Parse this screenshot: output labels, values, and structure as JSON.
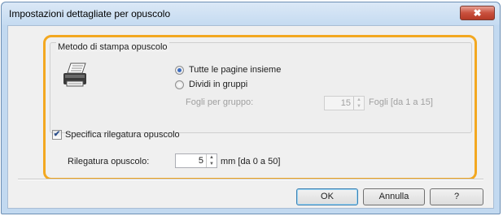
{
  "window": {
    "title": "Impostazioni dettagliate per opuscolo",
    "close_label": "✖"
  },
  "method_group": {
    "legend": "Metodo di stampa opuscolo",
    "option_all": "Tutte le pagine insieme",
    "option_groups": "Dividi in gruppi",
    "sheets_label": "Fogli per gruppo:",
    "sheets_value": "15",
    "sheets_range": "Fogli [da 1 a 15]",
    "selected_option": "Tutte le pagine insieme"
  },
  "binding": {
    "checkbox_label": "Specifica rilegatura opuscolo",
    "checked": true,
    "field_label": "Rilegatura opuscolo:",
    "value": "5",
    "unit_range": "mm [da 0 a 50]"
  },
  "buttons": {
    "ok": "OK",
    "cancel": "Annulla",
    "help": "?"
  },
  "icons": [
    "printer-icon",
    "close-icon",
    "spin-up-icon",
    "spin-down-icon",
    "checkmark-icon"
  ],
  "colors": {
    "highlight": "#f3a821",
    "title_bar": "#c5dbf1",
    "close_button": "#c9503d"
  }
}
